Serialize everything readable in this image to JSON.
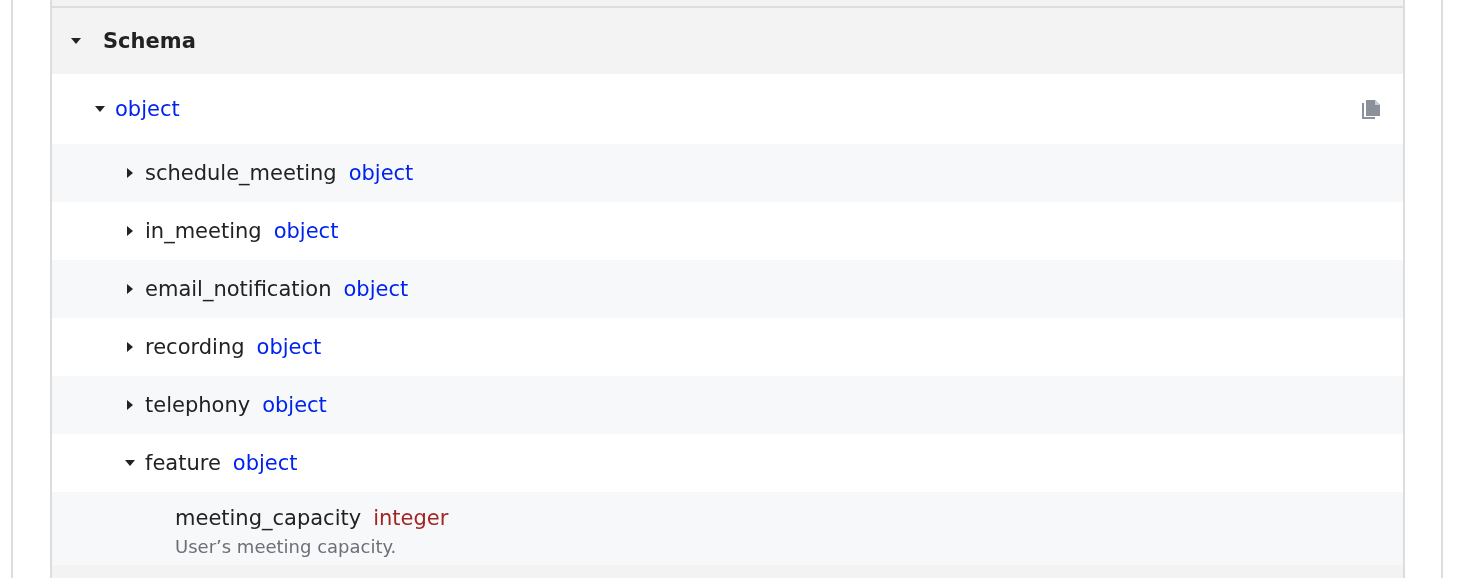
{
  "section": {
    "title": "Schema",
    "expanded": true
  },
  "schema": {
    "type": "object",
    "color": "#0022ee",
    "expanded": true,
    "children": [
      {
        "name": "schedule_meeting",
        "type": "object",
        "color": "#0022ee",
        "expanded": false
      },
      {
        "name": "in_meeting",
        "type": "object",
        "color": "#0022ee",
        "expanded": false
      },
      {
        "name": "email_notification",
        "type": "object",
        "color": "#0022ee",
        "expanded": false
      },
      {
        "name": "recording",
        "type": "object",
        "color": "#0022ee",
        "expanded": false
      },
      {
        "name": "telephony",
        "type": "object",
        "color": "#0022ee",
        "expanded": false
      },
      {
        "name": "feature",
        "type": "object",
        "color": "#0022ee",
        "expanded": true,
        "children": [
          {
            "name": "meeting_capacity",
            "type": "integer",
            "color": "#a32424",
            "description": "User’s meeting capacity."
          }
        ]
      }
    ]
  }
}
